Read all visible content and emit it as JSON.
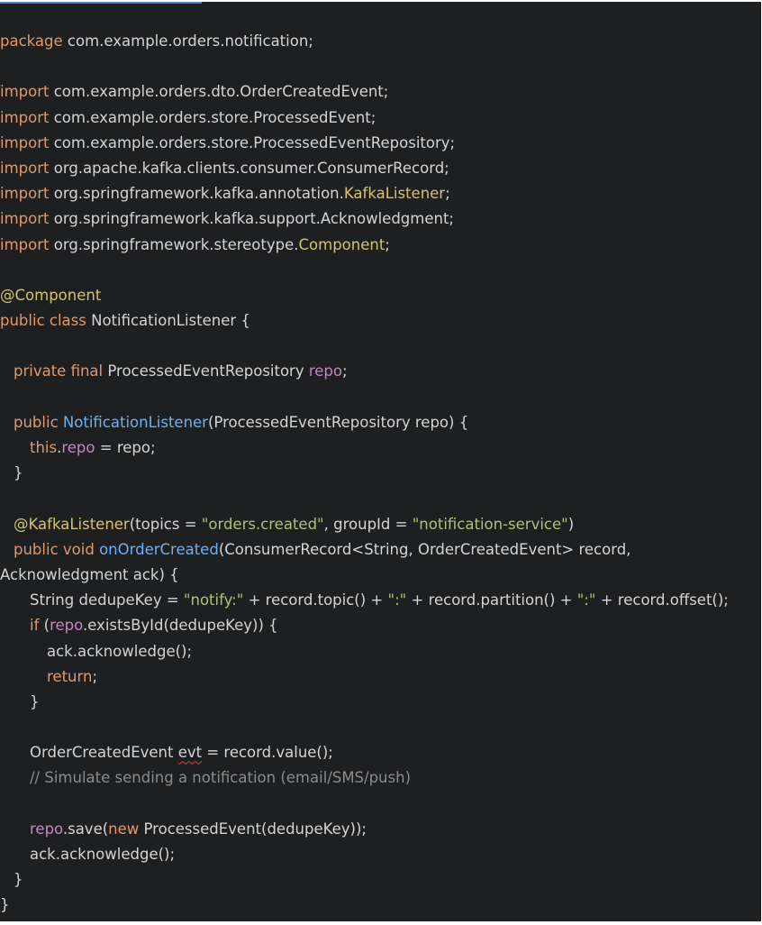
{
  "colors": {
    "background": "#1e1f21",
    "text": "#d4d4d4",
    "keyword": "#e0996a",
    "annotation": "#d2c36e",
    "function": "#6fb0f0",
    "field": "#c586c0",
    "string": "#a9c379",
    "comment": "#8b8b8b",
    "error_underline": "#d84a4a"
  },
  "code": {
    "lines": [
      {
        "indent": 0,
        "tokens": [
          {
            "t": "kw",
            "v": "package"
          },
          {
            "t": "p",
            "v": " com.example.orders.notification;"
          }
        ]
      },
      {
        "indent": 0,
        "tokens": []
      },
      {
        "indent": 0,
        "tokens": [
          {
            "t": "kw",
            "v": "import"
          },
          {
            "t": "p",
            "v": " com.example.orders.dto.OrderCreatedEvent;"
          }
        ]
      },
      {
        "indent": 0,
        "tokens": [
          {
            "t": "kw",
            "v": "import"
          },
          {
            "t": "p",
            "v": " com.example.orders.store.ProcessedEvent;"
          }
        ]
      },
      {
        "indent": 0,
        "tokens": [
          {
            "t": "kw",
            "v": "import"
          },
          {
            "t": "p",
            "v": " com.example.orders.store.ProcessedEventRepository;"
          }
        ]
      },
      {
        "indent": 0,
        "tokens": [
          {
            "t": "kw",
            "v": "import"
          },
          {
            "t": "p",
            "v": " org.apache.kafka.clients.consumer.ConsumerRecord;"
          }
        ]
      },
      {
        "indent": 0,
        "tokens": [
          {
            "t": "kw",
            "v": "import"
          },
          {
            "t": "p",
            "v": " org.springframework.kafka.annotation."
          },
          {
            "t": "ann",
            "v": "KafkaListener"
          },
          {
            "t": "p",
            "v": ";"
          }
        ]
      },
      {
        "indent": 0,
        "tokens": [
          {
            "t": "kw",
            "v": "import"
          },
          {
            "t": "p",
            "v": " org.springframework.kafka.support.Acknowledgment;"
          }
        ]
      },
      {
        "indent": 0,
        "tokens": [
          {
            "t": "kw",
            "v": "import"
          },
          {
            "t": "p",
            "v": " org.springframework.stereotype."
          },
          {
            "t": "ann",
            "v": "Component"
          },
          {
            "t": "p",
            "v": ";"
          }
        ]
      },
      {
        "indent": 0,
        "tokens": []
      },
      {
        "indent": 0,
        "tokens": [
          {
            "t": "ann",
            "v": "@Component"
          }
        ]
      },
      {
        "indent": 0,
        "tokens": [
          {
            "t": "kw",
            "v": "public class"
          },
          {
            "t": "p",
            "v": " NotificationListener {"
          }
        ]
      },
      {
        "indent": 0,
        "tokens": []
      },
      {
        "indent": 1,
        "tokens": [
          {
            "t": "kw",
            "v": "private final"
          },
          {
            "t": "p",
            "v": " ProcessedEventRepository "
          },
          {
            "t": "fld",
            "v": "repo"
          },
          {
            "t": "p",
            "v": ";"
          }
        ]
      },
      {
        "indent": 0,
        "tokens": []
      },
      {
        "indent": 1,
        "tokens": [
          {
            "t": "kw",
            "v": "public"
          },
          {
            "t": "p",
            "v": " "
          },
          {
            "t": "fn",
            "v": "NotificationListener"
          },
          {
            "t": "p",
            "v": "(ProcessedEventRepository repo) {"
          }
        ]
      },
      {
        "indent": 2,
        "tokens": [
          {
            "t": "kw",
            "v": "this"
          },
          {
            "t": "p",
            "v": "."
          },
          {
            "t": "fld",
            "v": "repo"
          },
          {
            "t": "p",
            "v": " = repo;"
          }
        ]
      },
      {
        "indent": 1,
        "tokens": [
          {
            "t": "p",
            "v": "}"
          }
        ]
      },
      {
        "indent": 0,
        "tokens": []
      },
      {
        "indent": 1,
        "tokens": [
          {
            "t": "ann",
            "v": "@KafkaListener"
          },
          {
            "t": "p",
            "v": "(topics = "
          },
          {
            "t": "str",
            "v": "\"orders.created\""
          },
          {
            "t": "p",
            "v": ", groupId = "
          },
          {
            "t": "str",
            "v": "\"notification-service\""
          },
          {
            "t": "p",
            "v": ")"
          }
        ]
      },
      {
        "indent": 1,
        "tokens": [
          {
            "t": "kw",
            "v": "public void"
          },
          {
            "t": "p",
            "v": " "
          },
          {
            "t": "fn",
            "v": "onOrderCreated"
          },
          {
            "t": "p",
            "v": "(ConsumerRecord<String, OrderCreatedEvent> record,"
          }
        ]
      },
      {
        "indent": 0,
        "tokens": [
          {
            "t": "p",
            "v": "Acknowledgment ack) {"
          }
        ]
      },
      {
        "indent": 2,
        "tokens": [
          {
            "t": "p",
            "v": "String dedupeKey = "
          },
          {
            "t": "str",
            "v": "\"notify:\""
          },
          {
            "t": "p",
            "v": " + record.topic() + "
          },
          {
            "t": "str",
            "v": "\":\""
          },
          {
            "t": "p",
            "v": " + record.partition() + "
          },
          {
            "t": "str",
            "v": "\":\""
          },
          {
            "t": "p",
            "v": " + record.offset();"
          }
        ]
      },
      {
        "indent": 2,
        "tokens": [
          {
            "t": "kw",
            "v": "if"
          },
          {
            "t": "p",
            "v": " ("
          },
          {
            "t": "fld",
            "v": "repo"
          },
          {
            "t": "p",
            "v": ".existsById(dedupeKey)) {"
          }
        ]
      },
      {
        "indent": 3,
        "tokens": [
          {
            "t": "p",
            "v": "ack.acknowledge();"
          }
        ]
      },
      {
        "indent": 3,
        "tokens": [
          {
            "t": "kw",
            "v": "return"
          },
          {
            "t": "p",
            "v": ";"
          }
        ]
      },
      {
        "indent": 2,
        "tokens": [
          {
            "t": "p",
            "v": "}"
          }
        ]
      },
      {
        "indent": 0,
        "tokens": []
      },
      {
        "indent": 2,
        "tokens": [
          {
            "t": "p",
            "v": "OrderCreatedEvent "
          },
          {
            "t": "err",
            "v": "evt"
          },
          {
            "t": "p",
            "v": " = record.value();"
          }
        ]
      },
      {
        "indent": 2,
        "tokens": [
          {
            "t": "cmt",
            "v": "// Simulate sending a notification (email/SMS/push)"
          }
        ]
      },
      {
        "indent": 0,
        "tokens": []
      },
      {
        "indent": 2,
        "tokens": [
          {
            "t": "fld",
            "v": "repo"
          },
          {
            "t": "p",
            "v": ".save("
          },
          {
            "t": "kw",
            "v": "new"
          },
          {
            "t": "p",
            "v": " ProcessedEvent(dedupeKey));"
          }
        ]
      },
      {
        "indent": 2,
        "tokens": [
          {
            "t": "p",
            "v": "ack.acknowledge();"
          }
        ]
      },
      {
        "indent": 1,
        "tokens": [
          {
            "t": "p",
            "v": "}"
          }
        ]
      },
      {
        "indent": 0,
        "tokens": [
          {
            "t": "p",
            "v": "}"
          }
        ]
      }
    ]
  }
}
